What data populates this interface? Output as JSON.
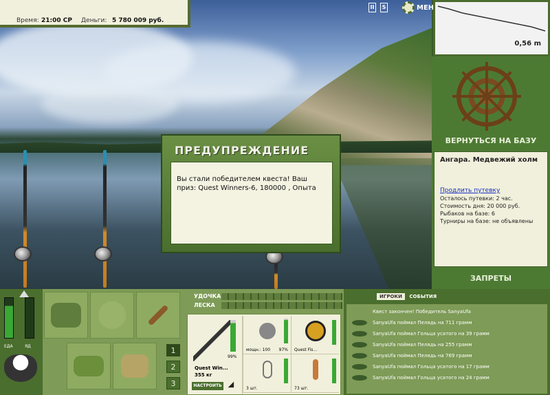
{
  "status": {
    "time_label": "Время:",
    "time_value": "21:00 СР",
    "money_label": "Деньги:",
    "money_value": "5 780 009 руб."
  },
  "toolbar": {
    "pause_label": "II",
    "sound_label": "S",
    "menu_label": "МЕНЮ"
  },
  "depth": {
    "value": "0,56 m"
  },
  "side": {
    "return_label": "ВЕРНУТЬСЯ НА БАЗУ",
    "location": "Ангара. Медвежий холм",
    "extend_link": "Продлить путевку",
    "lines": [
      "Осталось путевки: 2 час.",
      "Стоимость дня: 20 000 руб.",
      "Рыбаков на базе: 6",
      "Турниры на базе: не объявлены"
    ],
    "bans_label": "ЗАПРЕТЫ"
  },
  "dialog": {
    "title": "ПРЕДУПРЕЖДЕНИЕ",
    "message": "Вы стали победителем квеста! Ваш приз: Quest Winners-6, 180000 , Опыта"
  },
  "controls": {
    "eat_label": "ЕДА",
    "ok_label": "ЯД",
    "slots": [
      "1",
      "2",
      "3"
    ]
  },
  "rodline": {
    "rod_label": "УДОЧКА",
    "line_label": "ЛЕСКА"
  },
  "gear": {
    "rod_pct": "99%",
    "rod_name": "Quest Win...",
    "rod_weight": "355 кг",
    "setup_label": "НАСТРОИТЬ",
    "reel_text": "мощн.: 100",
    "reel_pct": "97%",
    "line_text": "Quest Fis...",
    "hook_text": "3 шт.",
    "worm_text": "73 шт."
  },
  "events": {
    "tab_players": "ИГРОКИ",
    "tab_events": "СОБЫТИЯ",
    "header": "Квест закончен! Победитель SanyaUfa",
    "rows": [
      "SanyaUfa поймал Пелядь на 711 грамм",
      "SanyaUfa поймал Гольца усатого на 39 грамм",
      "SanyaUfa поймал Пелядь на 255 грамм",
      "SanyaUfa поймал Пелядь на 769 грамм",
      "SanyaUfa поймал Гольца усатого на 17 грамм",
      "SanyaUfa поймал Гольца усатого на 24 грамм"
    ]
  },
  "colors": {
    "panel_green": "#4a6e2d",
    "light_panel": "#f1f0dc",
    "accent_text": "#e8f0d8"
  }
}
